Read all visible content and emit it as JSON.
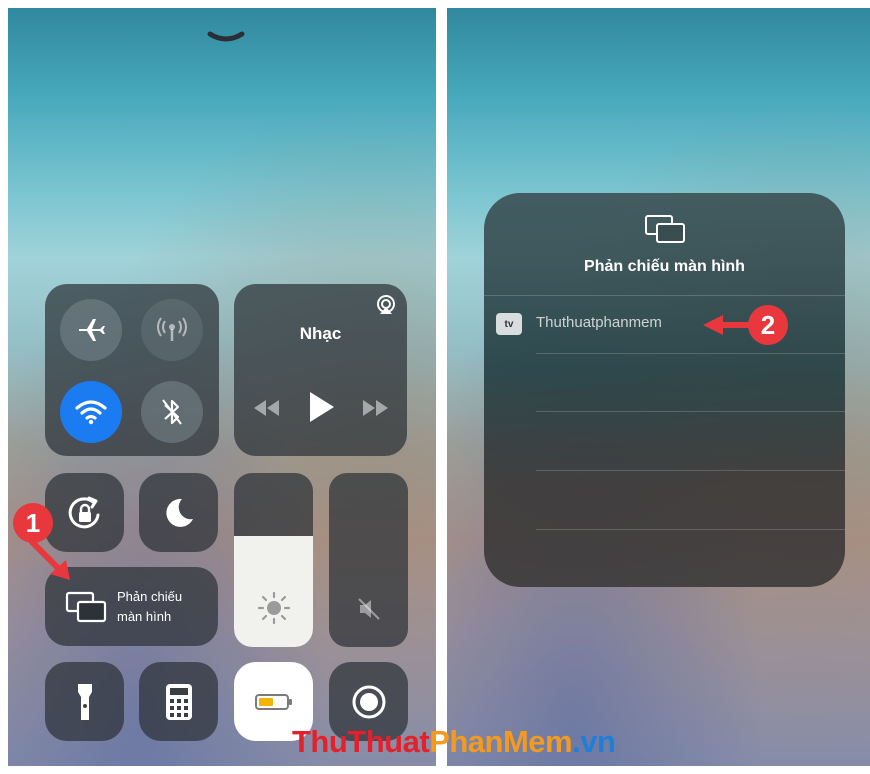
{
  "control_center": {
    "music": {
      "title": "Nhạc"
    },
    "screen_mirror": {
      "label_line1": "Phản chiếu",
      "label_line2": "màn hình"
    },
    "accent_color": "#1b7cf2"
  },
  "mirror_popup": {
    "title": "Phản chiếu màn hình",
    "devices": [
      {
        "badge": "tv",
        "name": "Thuthuatphanmem"
      }
    ]
  },
  "annotations": {
    "step1": "1",
    "step2": "2",
    "color": "#e8383d"
  },
  "watermark": {
    "part1": "ThuThuat",
    "part2": "PhanMem",
    "part3": ".vn"
  }
}
